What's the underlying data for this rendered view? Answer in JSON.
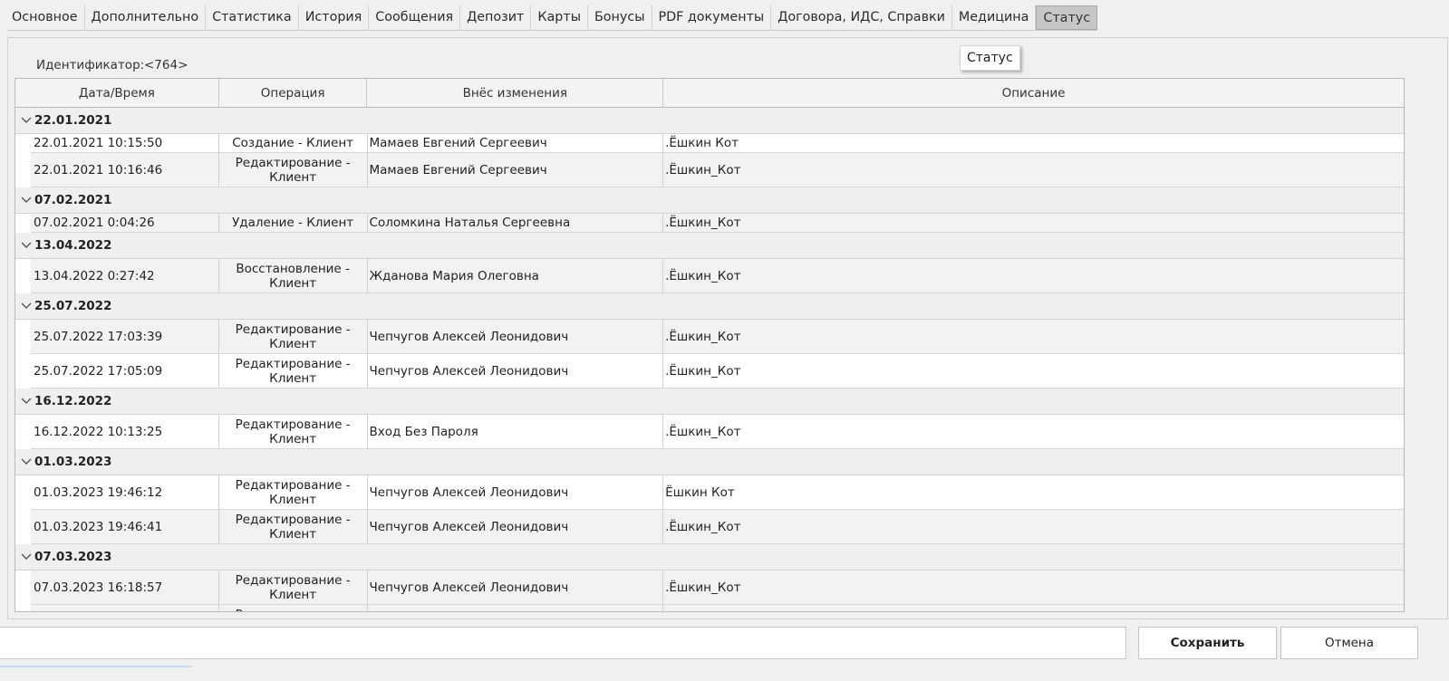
{
  "tabs": [
    {
      "label": "Основное",
      "active": false
    },
    {
      "label": "Дополнительно",
      "active": false
    },
    {
      "label": "Статистика",
      "active": false
    },
    {
      "label": "История",
      "active": false
    },
    {
      "label": "Сообщения",
      "active": false
    },
    {
      "label": "Депозит",
      "active": false
    },
    {
      "label": "Карты",
      "active": false
    },
    {
      "label": "Бонусы",
      "active": false
    },
    {
      "label": "PDF документы",
      "active": false
    },
    {
      "label": "Договора, ИДС, Справки",
      "active": false
    },
    {
      "label": "Медицина",
      "active": false
    },
    {
      "label": "Статус",
      "active": true
    }
  ],
  "identifier": {
    "label": "Идентификатор:",
    "value": "<764>"
  },
  "tooltip": {
    "text": "Статус"
  },
  "grid": {
    "columns": [
      "Дата/Время",
      "Операция",
      "Внёс изменения",
      "Описание"
    ],
    "groups": [
      {
        "date": "22.01.2021",
        "rows": [
          {
            "datetime": "22.01.2021 10:15:50",
            "operation": "Создание - Клиент",
            "author": "Мамаев Евгений Сергеевич",
            "description": ".Ёшкин Кот"
          },
          {
            "datetime": "22.01.2021 10:16:46",
            "operation": "Редактирование - Клиент",
            "author": "Мамаев Евгений Сергеевич",
            "description": " .Ёшкин_Кот"
          }
        ]
      },
      {
        "date": "07.02.2021",
        "rows": [
          {
            "datetime": "07.02.2021 0:04:26",
            "operation": "Удаление - Клиент",
            "author": "Соломкина Наталья Сергеевна",
            "description": ".Ёшкин_Кот"
          }
        ]
      },
      {
        "date": "13.04.2022",
        "rows": [
          {
            "datetime": "13.04.2022 0:27:42",
            "operation": "Восстановление - Клиент",
            "author": "Жданова Мария Олеговна",
            "description": ".Ёшкин_Кот"
          }
        ]
      },
      {
        "date": "25.07.2022",
        "rows": [
          {
            "datetime": "25.07.2022 17:03:39",
            "operation": "Редактирование - Клиент",
            "author": "Чепчугов Алексей Леонидович",
            "description": ".Ёшкин_Кот"
          },
          {
            "datetime": "25.07.2022 17:05:09",
            "operation": "Редактирование - Клиент",
            "author": "Чепчугов Алексей Леонидович",
            "description": ".Ёшкин_Кот"
          }
        ]
      },
      {
        "date": "16.12.2022",
        "rows": [
          {
            "datetime": "16.12.2022 10:13:25",
            "operation": "Редактирование - Клиент",
            "author": "Вход Без Пароля",
            "description": ".Ёшкин_Кот"
          }
        ]
      },
      {
        "date": "01.03.2023",
        "rows": [
          {
            "datetime": "01.03.2023 19:46:12",
            "operation": "Редактирование - Клиент",
            "author": "Чепчугов Алексей Леонидович",
            "description": "Ёшкин Кот"
          },
          {
            "datetime": "01.03.2023 19:46:41",
            "operation": "Редактирование - Клиент",
            "author": "Чепчугов Алексей Леонидович",
            "description": ".Ёшкин_Кот"
          }
        ]
      },
      {
        "date": "07.03.2023",
        "rows": [
          {
            "datetime": "07.03.2023 16:18:57",
            "operation": "Редактирование - Клиент",
            "author": "Чепчугов Алексей Леонидович",
            "description": ".Ёшкин_Кот"
          },
          {
            "datetime": "",
            "operation": "Редактирование - Клиент",
            "author": "",
            "description": ""
          }
        ]
      }
    ]
  },
  "buttons": {
    "save": "Сохранить",
    "cancel": "Отмена"
  },
  "colors": {
    "active_tab": "#c7c7c7",
    "group_row": "#efefef",
    "alt_row": "#f2f2f2"
  }
}
